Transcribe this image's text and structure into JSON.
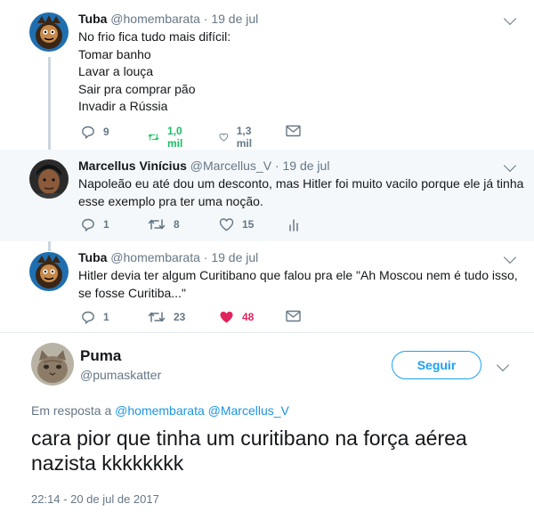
{
  "thread": [
    {
      "name": "Tuba",
      "handle": "@homembarata",
      "sep": "·",
      "date": "19 de jul",
      "lines": [
        "No frio fica tudo mais difícil:",
        "Tomar banho",
        "Lavar a louça",
        "Sair pra comprar pão",
        "Invadir a Rússia"
      ],
      "replies": "9",
      "retweets": "1,0 mil",
      "likes": "1,3 mil",
      "avatar_icon": "cartoon-avatar-icon"
    },
    {
      "name": "Marcellus Vinícius",
      "handle": "@Marcellus_V",
      "sep": "·",
      "date": "19 de jul",
      "lines": [
        "Napoleão eu até dou um desconto, mas Hitler foi muito vacilo porque ele já tinha",
        "esse exemplo pra ter uma noção."
      ],
      "replies": "1",
      "retweets": "8",
      "likes": "15",
      "avatar_icon": "profile-photo-icon"
    },
    {
      "name": "Tuba",
      "handle": "@homembarata",
      "sep": "·",
      "date": "19 de jul",
      "lines": [
        "Hitler devia ter algum Curitibano que falou pra ele \"Ah Moscou nem é tudo isso,",
        "se fosse Curitiba...\""
      ],
      "replies": "1",
      "retweets": "23",
      "likes": "48",
      "avatar_icon": "cartoon-avatar-icon"
    }
  ],
  "main_tweet": {
    "name": "Puma",
    "handle": "@pumaskatter",
    "follow_label": "Seguir",
    "reply_prefix": "Em resposta a",
    "reply_mention_1": "@homembarata",
    "reply_mention_2": "@Marcellus_V",
    "text": "cara pior que tinha um  curitibano na força aérea nazista kkkkkkkk",
    "timestamp": "22:14 - 20 de jul de 2017",
    "avatar_icon": "cat-avatar-icon"
  },
  "colors": {
    "accent": "#1da1f2",
    "retweet_active": "#17bf63",
    "like_active": "#e0245e",
    "muted_text": "#657786"
  }
}
